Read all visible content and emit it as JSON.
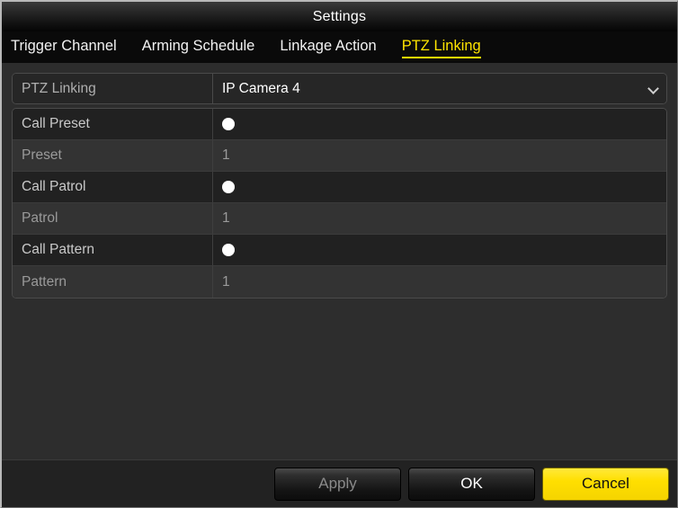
{
  "window": {
    "title": "Settings"
  },
  "tabs": [
    {
      "label": "Trigger Channel",
      "active": false
    },
    {
      "label": "Arming Schedule",
      "active": false
    },
    {
      "label": "Linkage Action",
      "active": false
    },
    {
      "label": "PTZ Linking",
      "active": true
    }
  ],
  "select_row": {
    "label": "PTZ Linking",
    "value": "IP Camera 4",
    "chevron_icon": "chevron-down-icon"
  },
  "properties": [
    {
      "label": "Call Preset",
      "type": "radio",
      "value": "",
      "checked": true
    },
    {
      "label": "Preset",
      "type": "text",
      "value": "1"
    },
    {
      "label": "Call Patrol",
      "type": "radio",
      "value": "",
      "checked": true
    },
    {
      "label": "Patrol",
      "type": "text",
      "value": "1"
    },
    {
      "label": "Call Pattern",
      "type": "radio",
      "value": "",
      "checked": true
    },
    {
      "label": "Pattern",
      "type": "text",
      "value": "1"
    }
  ],
  "footer": {
    "apply_label": "Apply",
    "ok_label": "OK",
    "cancel_label": "Cancel"
  },
  "colors": {
    "accent_yellow": "#ffe400",
    "window_bg": "#2d2d2d",
    "row_dark": "#212121",
    "row_light": "#333333",
    "footer_bg": "#222222"
  }
}
